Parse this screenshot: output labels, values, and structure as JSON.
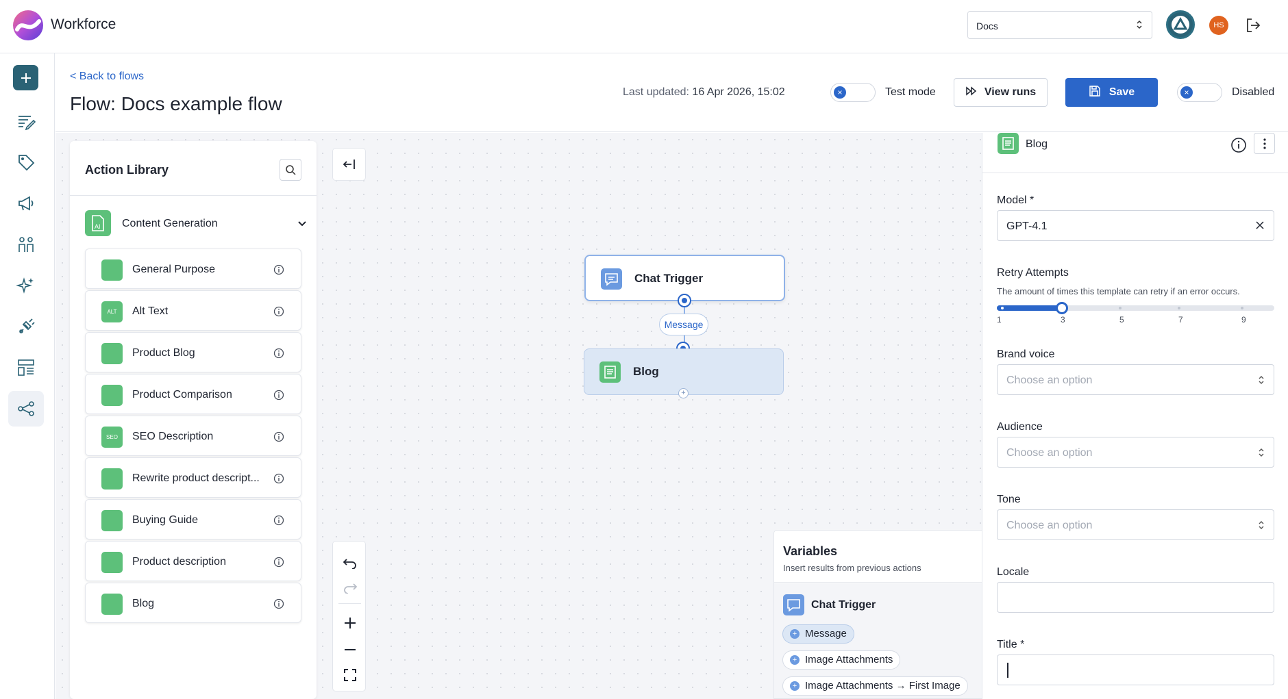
{
  "app": {
    "name": "Workforce"
  },
  "topbar": {
    "org_select_value": "Docs",
    "user_initials": "HS"
  },
  "header": {
    "back_link": "< Back to flows",
    "title_prefix": "Flow:",
    "title_name": "Docs example flow",
    "last_updated_label": "Last updated:",
    "last_updated_value": "16 Apr 2026, 15:02",
    "test_mode_label": "Test mode",
    "view_runs_label": "View runs",
    "save_label": "Save",
    "disabled_label": "Disabled"
  },
  "library": {
    "title": "Action Library",
    "category": "Content Generation",
    "category_icon_text": "AI",
    "items": [
      {
        "label": "General Purpose",
        "icon_text": ""
      },
      {
        "label": "Alt Text",
        "icon_text": "ALT"
      },
      {
        "label": "Product Blog",
        "icon_text": ""
      },
      {
        "label": "Product Comparison",
        "icon_text": ""
      },
      {
        "label": "SEO Description",
        "icon_text": "SEO"
      },
      {
        "label": "Rewrite product descript...",
        "icon_text": ""
      },
      {
        "label": "Buying Guide",
        "icon_text": ""
      },
      {
        "label": "Product description",
        "icon_text": ""
      },
      {
        "label": "Blog",
        "icon_text": ""
      }
    ]
  },
  "canvas": {
    "trigger_node": "Chat Trigger",
    "edge_label": "Message",
    "blog_node": "Blog"
  },
  "variables": {
    "title": "Variables",
    "subtitle": "Insert results from previous actions",
    "source": "Chat Trigger",
    "chips": [
      "Message",
      "Image Attachments",
      "Image Attachments → First Image"
    ]
  },
  "panel": {
    "title": "Blog",
    "model_label": "Model *",
    "model_value": "GPT-4.1",
    "retry_label": "Retry Attempts",
    "retry_helper": "The amount of times this template can retry if an error occurs.",
    "retry_ticks": [
      "1",
      "3",
      "5",
      "7",
      "9"
    ],
    "retry_value": 3,
    "retry_min": 1,
    "retry_max": 10,
    "brand_voice_label": "Brand voice",
    "audience_label": "Audience",
    "tone_label": "Tone",
    "placeholder": "Choose an option",
    "locale_label": "Locale",
    "title_label": "Title *"
  },
  "colors": {
    "primary": "#2b66c9",
    "accent_teal": "#2a6275",
    "green_icon": "#5dc07a",
    "node_blue": "#6b9ae0"
  }
}
